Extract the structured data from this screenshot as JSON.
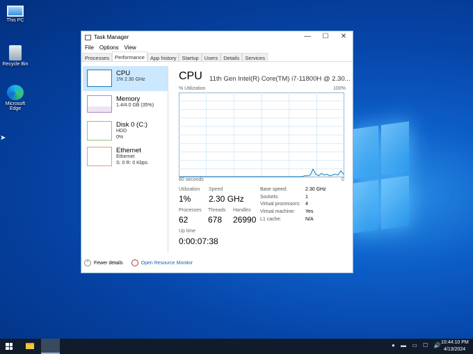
{
  "desktop": {
    "icons": [
      {
        "label": "This PC"
      },
      {
        "label": "Recycle Bin"
      },
      {
        "label": "Microsoft Edge"
      }
    ]
  },
  "window": {
    "title": "Task Manager",
    "controls": {
      "minimize": "—",
      "maximize": "☐",
      "close": "✕"
    },
    "menu": [
      "File",
      "Options",
      "View"
    ],
    "tabs": [
      "Processes",
      "Performance",
      "App history",
      "Startup",
      "Users",
      "Details",
      "Services"
    ],
    "active_tab": "Performance"
  },
  "sidebar": [
    {
      "name": "CPU",
      "sub1": "1% 2.30 GHz",
      "color": "#117dbb"
    },
    {
      "name": "Memory",
      "sub1": "1.4/4.0 GB (35%)",
      "color": "#8b12ae",
      "fill": 0.35
    },
    {
      "name": "Disk 0 (C:)",
      "sub1": "HDD",
      "sub2": "0%",
      "color": "#4da60c"
    },
    {
      "name": "Ethernet",
      "sub1": "Ethernet",
      "sub2": "S: 0 R: 0 Kbps",
      "color": "#a74f01"
    }
  ],
  "cpu": {
    "title": "CPU",
    "model": "11th Gen Intel(R) Core(TM) i7-11800H @ 2.30...",
    "graph": {
      "ylabel": "% Utilization",
      "ymax_label": "100%",
      "xleft": "60 seconds",
      "xright": "0"
    },
    "stats": {
      "utilization_label": "Utilization",
      "utilization": "1%",
      "speed_label": "Speed",
      "speed": "2.30 GHz",
      "processes_label": "Processes",
      "processes": "62",
      "threads_label": "Threads",
      "threads": "678",
      "handles_label": "Handles",
      "handles": "26990",
      "uptime_label": "Up time",
      "uptime": "0:00:07:38"
    },
    "details": [
      [
        "Base speed:",
        "2.30 GHz"
      ],
      [
        "Sockets:",
        "1"
      ],
      [
        "Virtual processors:",
        "4"
      ],
      [
        "Virtual machine:",
        "Yes"
      ],
      [
        "L1 cache:",
        "N/A"
      ]
    ]
  },
  "chart_data": {
    "type": "area",
    "title": "CPU % Utilization",
    "ylim": [
      0,
      100
    ],
    "xlabel": "60 seconds",
    "x_range": [
      60,
      0
    ],
    "values": [
      0,
      0,
      0,
      0,
      0,
      0,
      0,
      0,
      0,
      0,
      0,
      0,
      0,
      0,
      0,
      0,
      0,
      0,
      0,
      0,
      0,
      0,
      0,
      0,
      0,
      0,
      0,
      0,
      0,
      0,
      0,
      0,
      0,
      0,
      0,
      0,
      0,
      0,
      0,
      0,
      0,
      0,
      0,
      0,
      0,
      1,
      1,
      2,
      9,
      3,
      1,
      4,
      2,
      3,
      1,
      2,
      3,
      2,
      7,
      3
    ]
  },
  "footer": {
    "fewer": "Fewer details",
    "monitor": "Open Resource Monitor"
  },
  "tray": {
    "time": "10:44:10 PM",
    "date": "4/13/2024"
  }
}
